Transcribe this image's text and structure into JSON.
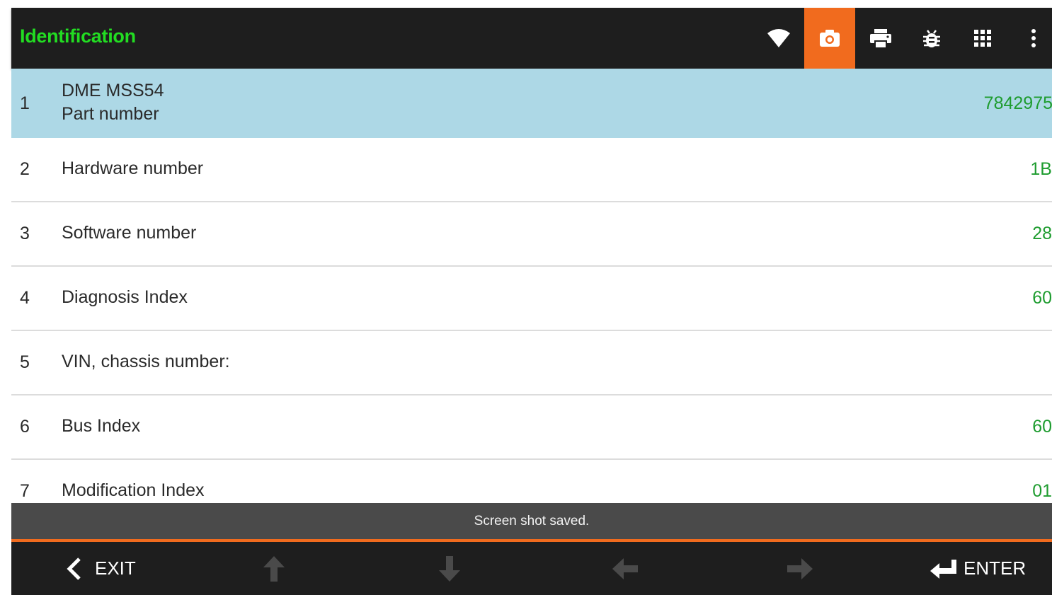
{
  "colors": {
    "title": "#22dd22",
    "appbar_bg": "#1e1e1e",
    "accent": "#f16b1e",
    "selected_row": "#add8e6",
    "value": "#1e9c2f",
    "toast_bg": "#4a4a4a"
  },
  "header": {
    "title": "Identification",
    "icons": [
      "wifi-icon",
      "camera-icon",
      "print-icon",
      "bug-icon",
      "grid-icon",
      "more-vert-icon"
    ]
  },
  "rows": [
    {
      "num": "1",
      "line1": "DME MSS54",
      "line2": "Part number",
      "value": "7842975"
    },
    {
      "num": "2",
      "label": "Hardware number",
      "value": "1B"
    },
    {
      "num": "3",
      "label": "Software number",
      "value": "28"
    },
    {
      "num": "4",
      "label": "Diagnosis Index",
      "value": "60"
    },
    {
      "num": "5",
      "label": "VIN, chassis number:",
      "value": ""
    },
    {
      "num": "6",
      "label": "Bus Index",
      "value": "60"
    },
    {
      "num": "7",
      "label": "Modification Index",
      "value": "01"
    }
  ],
  "toast": "Screen shot saved.",
  "footer": {
    "exit_label": "EXIT",
    "enter_label": "ENTER",
    "icons": [
      "arrow-up-icon",
      "arrow-down-icon",
      "arrow-left-icon",
      "arrow-right-icon"
    ]
  }
}
